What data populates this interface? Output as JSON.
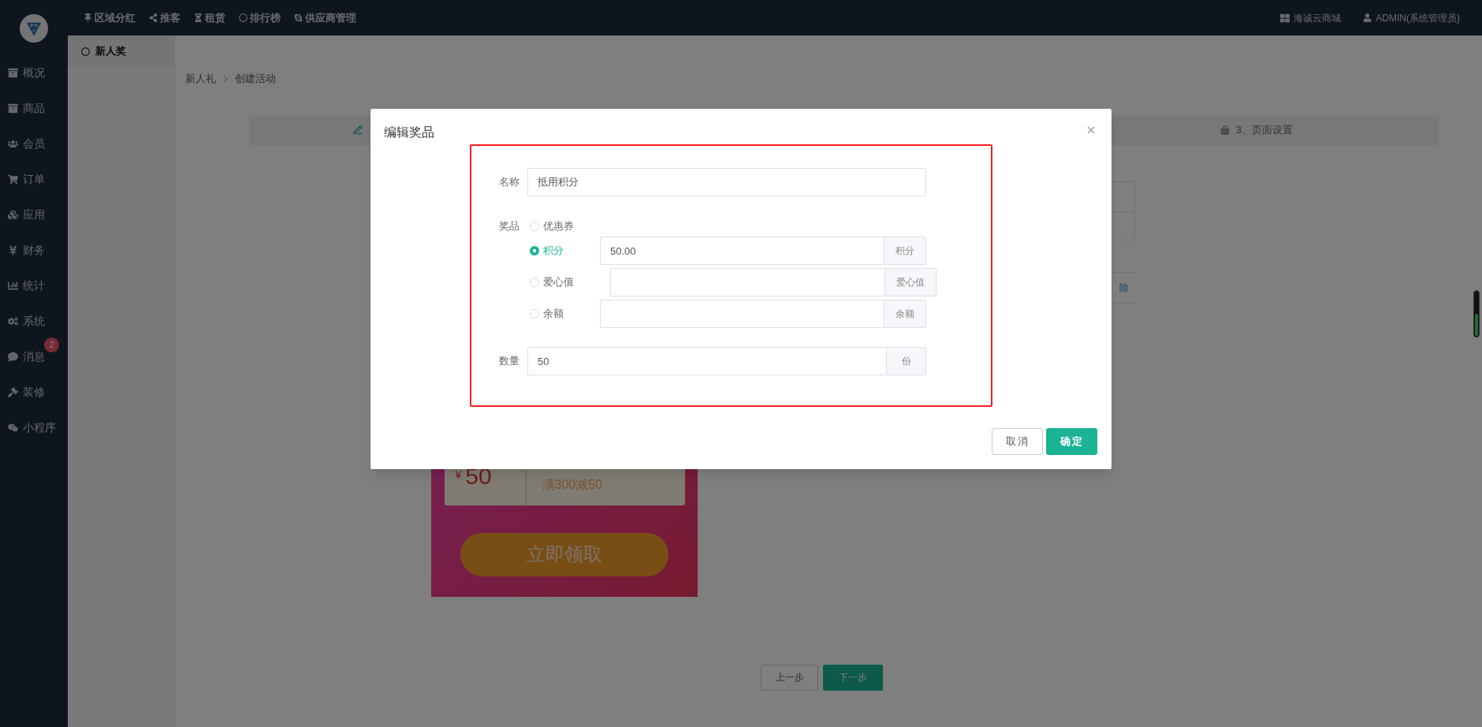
{
  "top_nav": {
    "links": [
      {
        "label": "区域分红"
      },
      {
        "label": "推客"
      },
      {
        "label": "租赁"
      },
      {
        "label": "排行榜"
      },
      {
        "label": "供应商管理"
      }
    ],
    "store": "海诚云商城",
    "user": "ADMIN(系统管理员)"
  },
  "sidebar": {
    "items": [
      {
        "label": "概况"
      },
      {
        "label": "商品"
      },
      {
        "label": "会员"
      },
      {
        "label": "订单"
      },
      {
        "label": "应用"
      },
      {
        "label": "财务"
      },
      {
        "label": "统计"
      },
      {
        "label": "系统"
      },
      {
        "label": "消息",
        "badge": "2"
      },
      {
        "label": "装修"
      },
      {
        "label": "小程序"
      }
    ]
  },
  "sub_sidebar": {
    "items": [
      {
        "label": "新人奖",
        "selected": true
      }
    ]
  },
  "breadcrumb": [
    "新人礼",
    "创建活动"
  ],
  "steps": [
    {
      "label": "3、页面设置"
    }
  ],
  "table_fragment": {
    "cell": "除"
  },
  "coupon_preview": {
    "currency": "¥",
    "amount": "50",
    "condition": "满300减50",
    "button": "立即领取"
  },
  "footer_buttons": [
    {
      "label": "上一步",
      "kind": "secondary"
    },
    {
      "label": "下一步",
      "kind": "primary"
    }
  ],
  "modal": {
    "title": "编辑奖品",
    "name_field": {
      "label": "名称",
      "value": "抵用积分"
    },
    "prize": {
      "label": "奖品",
      "options": [
        {
          "label": "优惠券",
          "selected": false
        },
        {
          "label": "积分",
          "selected": true,
          "value": "50.00",
          "unit": "积分"
        },
        {
          "label": "爱心值",
          "selected": false,
          "unit": "爱心值"
        },
        {
          "label": "余额",
          "selected": false,
          "unit": "余额"
        }
      ]
    },
    "quantity": {
      "label": "数量",
      "value": "50",
      "unit": "份"
    },
    "buttons": [
      {
        "label": "取消",
        "kind": "secondary"
      },
      {
        "label": "确定",
        "kind": "primary"
      }
    ]
  }
}
